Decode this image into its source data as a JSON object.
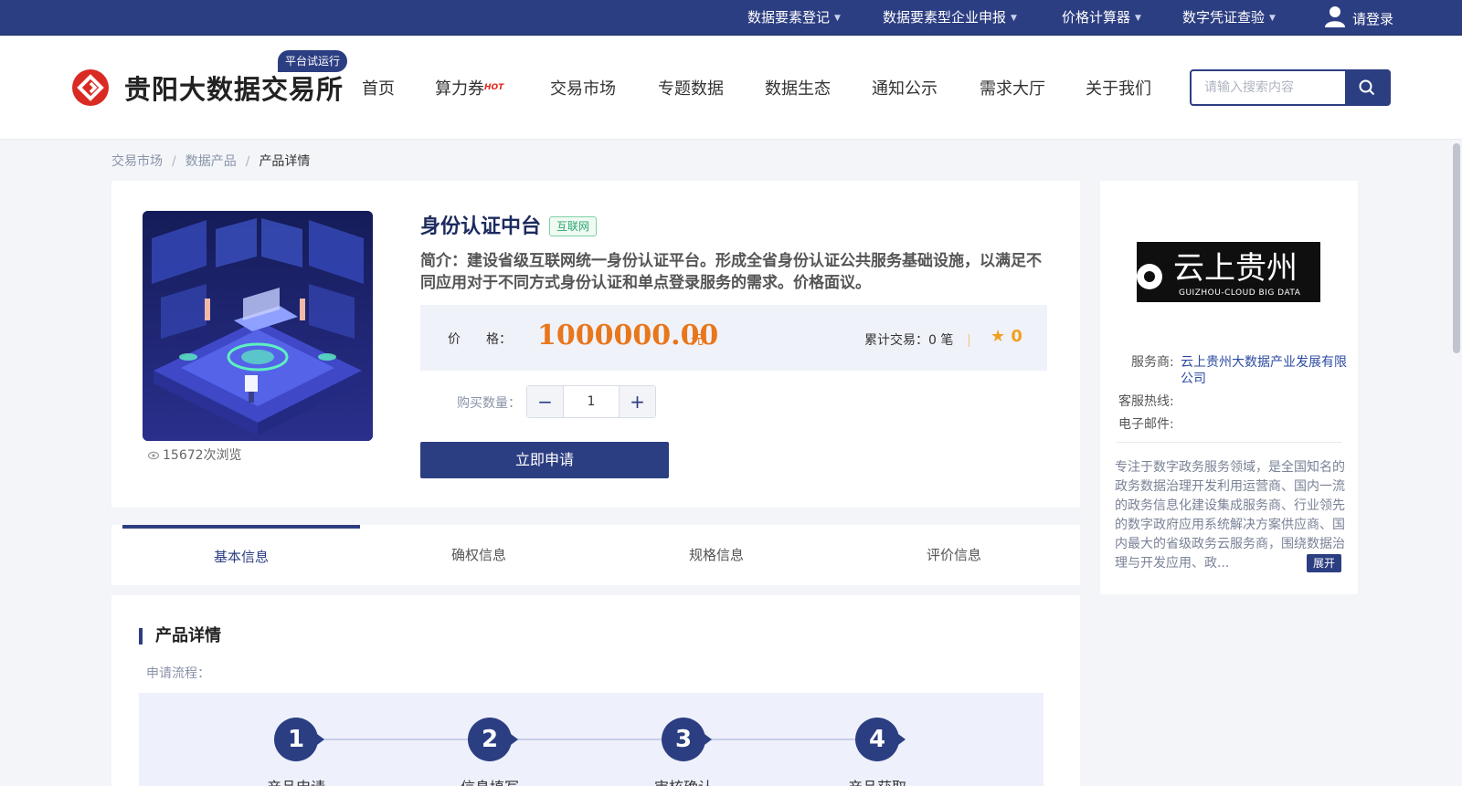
{
  "topbar": {
    "links": [
      "数据要素登记",
      "数据要素型企业申报",
      "价格计算器",
      "数字凭证查验"
    ],
    "login": "请登录"
  },
  "header": {
    "logo_text": "贵阳大数据交易所",
    "trial_badge": "平台试运行",
    "nav": [
      "首页",
      "算力券",
      "交易市场",
      "专题数据",
      "数据生态",
      "通知公示",
      "需求大厅",
      "关于我们"
    ],
    "hot_badge": "HOT",
    "search_placeholder": "请输入搜索内容"
  },
  "breadcrumb": [
    "交易市场",
    "数据产品",
    "产品详情"
  ],
  "product": {
    "title": "身份认证中台",
    "tag": "互联网",
    "description": "简介：建设省级互联网统一身份认证平台。形成全省身份认证公共服务基础设施，以满足不同应用对于不同方式身份认证和单点登录服务的需求。价格面议。",
    "price_label": "价　　格：",
    "price": "1000000.00",
    "price_unit": "元",
    "sales": "累计交易：0 笔",
    "rating": "0",
    "qty_label": "购买数量：",
    "qty": "1",
    "minus": "−",
    "plus": "+",
    "apply": "立即申请",
    "views": "15672次浏览"
  },
  "tabs": [
    "基本信息",
    "确权信息",
    "规格信息",
    "评价信息"
  ],
  "detail": {
    "title": "产品详情",
    "flow_label": "申请流程：",
    "steps": [
      {
        "num": "1",
        "label": "产品申请"
      },
      {
        "num": "2",
        "label": "信息填写"
      },
      {
        "num": "3",
        "label": "审核确认"
      },
      {
        "num": "4",
        "label": "产品获取"
      }
    ]
  },
  "provider": {
    "logo_cn": "云上贵州",
    "logo_en": "GUIZHOU-CLOUD BIG DATA",
    "provider_label": "服务商:",
    "provider_name": "云上贵州大数据产业发展有限公司",
    "hotline_label": "客服热线:",
    "email_label": "电子邮件:",
    "description": "专注于数字政务服务领域，是全国知名的政务数据治理开发利用运营商、国内一流的政务信息化建设集成服务商、行业领先的数字政府应用系统解决方案供应商、国内最大的省级政务云服务商，围绕数据治理与开发应用、政...",
    "expand": "展开"
  },
  "colors": {
    "brand": "#2c3e82",
    "price": "#e8761a",
    "tag": "#2ea56c"
  }
}
